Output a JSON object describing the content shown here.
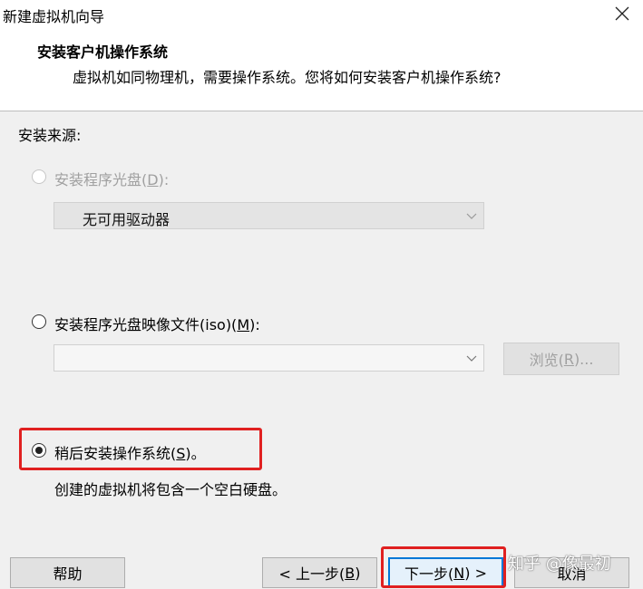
{
  "window": {
    "title": "新建虚拟机向导"
  },
  "header": {
    "title": "安装客户机操作系统",
    "subtitle": "虚拟机如同物理机，需要操作系统。您将如何安装客户机操作系统?"
  },
  "source": {
    "label": "安装来源:",
    "disc": {
      "label_pre": "安装程序光盘(",
      "mnemonic": "D",
      "label_post": "):",
      "selected": false,
      "enabled": false
    },
    "drive_combo": {
      "value": "无可用驱动器"
    },
    "iso": {
      "label_pre": "安装程序光盘映像文件(iso)(",
      "mnemonic": "M",
      "label_post": "):",
      "selected": false
    },
    "iso_combo": {
      "value": ""
    },
    "browse_button": {
      "label_pre": "浏览(",
      "mnemonic": "R",
      "label_post": ")..."
    },
    "later": {
      "label_pre": "稍后安装操作系统(",
      "mnemonic": "S",
      "label_post": ")。",
      "selected": true
    },
    "later_desc": "创建的虚拟机将包含一个空白硬盘。"
  },
  "footer": {
    "help": "帮助",
    "back": {
      "label_pre": "< 上一步(",
      "mnemonic": "B",
      "label_post": ")"
    },
    "next": {
      "label_pre": "下一步(",
      "mnemonic": "N",
      "label_post": ") >"
    },
    "cancel": "取消"
  },
  "watermark": "知乎 @像最初",
  "colors": {
    "highlight": "#e02020",
    "default_button_border": "#0078d7"
  }
}
